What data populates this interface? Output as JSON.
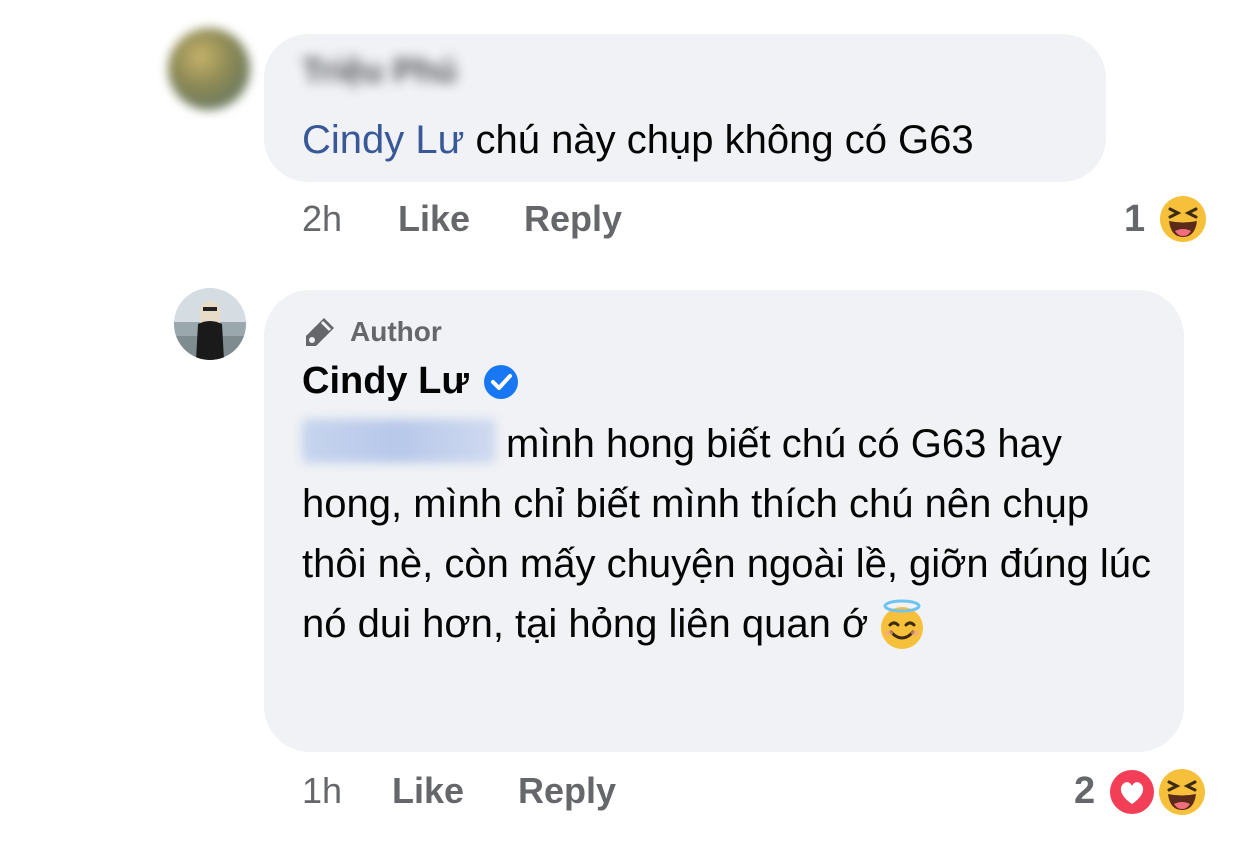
{
  "comments": [
    {
      "author": "Triệu Phú",
      "mention": "Cindy Lư",
      "text": "chú này chụp không có G63",
      "time": "2h",
      "like_label": "Like",
      "reply_label": "Reply",
      "reaction_count": "1",
      "reactions": [
        "laughing-emoji"
      ]
    },
    {
      "badge": "Author",
      "author": "Cindy Lư",
      "verified": true,
      "mention": "Triệu Phú",
      "text": "mình hong biết chú có G63 hay hong, mình chỉ biết mình thích chú nên chụp thôi nè, còn mấy chuyện ngoài lề, giỡn đúng lúc nó dui hơn, tại hỏng liên quan ớ",
      "emoji": "smiling-face-with-halo",
      "time": "1h",
      "like_label": "Like",
      "reply_label": "Reply",
      "reaction_count": "2",
      "reactions": [
        "heart-emoji",
        "laughing-emoji"
      ]
    }
  ],
  "colors": {
    "bubble": "#f0f2f5",
    "mention": "#385898",
    "meta": "#65676b",
    "verified": "#1877f2",
    "heart": "#f33e58",
    "emoji_yellow": "#f7c03b"
  }
}
